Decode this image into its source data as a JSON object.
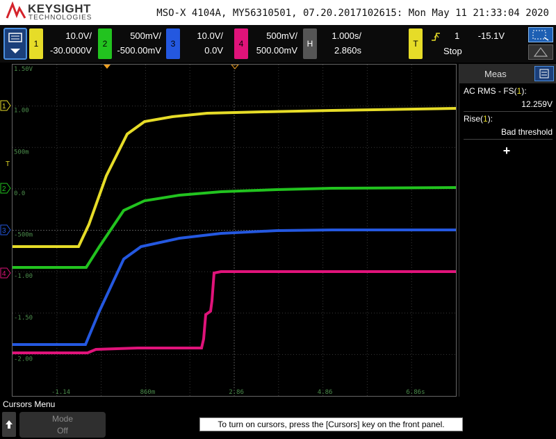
{
  "header": {
    "brand": "KEYSIGHT",
    "brand_sub": "TECHNOLOGIES",
    "title": "MSO-X 4104A, MY56310501, 07.20.2017102615: Mon May 11 21:33:04 2020"
  },
  "channels": [
    {
      "num": "1",
      "scale": "10.0V/",
      "offset": "-30.0000V",
      "color": "#e6dc28"
    },
    {
      "num": "2",
      "scale": "500mV/",
      "offset": "-500.00mV",
      "color": "#22c31f"
    },
    {
      "num": "3",
      "scale": "10.0V/",
      "offset": "0.0V",
      "color": "#2458e0"
    },
    {
      "num": "4",
      "scale": "500mV/",
      "offset": "500.00mV",
      "color": "#e0137a"
    }
  ],
  "horizontal": {
    "tab": "H",
    "timebase": "1.000s/",
    "delay": "2.860s"
  },
  "trigger": {
    "tab": "T",
    "source": "1",
    "level": "-15.1V",
    "state": "Stop",
    "color": "#e6dc28"
  },
  "graticule": {
    "y_labels": [
      "1.50V",
      "1.00",
      "500m",
      "0.0",
      "-500m",
      "-1.00",
      "-1.50",
      "-2.00"
    ],
    "x_labels": [
      "-1.14",
      "860m",
      "2.86",
      "4.86",
      "6.86s"
    ]
  },
  "markers": {
    "ch1": "1",
    "ch2": "2",
    "ch3": "3",
    "ch4": "4",
    "trig": "T"
  },
  "measurements": {
    "title": "Meas",
    "items": [
      {
        "label_pre": "AC RMS - FS(",
        "src": "1",
        "label_post": "):",
        "value": "12.259V"
      },
      {
        "label_pre": "Rise(",
        "src": "1",
        "label_post": "):",
        "value": "Bad threshold"
      }
    ],
    "add": "+"
  },
  "bottom": {
    "menu_title": "Cursors Menu",
    "mode_label": "Mode",
    "mode_value": "Off",
    "hint": "To turn on cursors, press the [Cursors] key on the front panel."
  }
}
